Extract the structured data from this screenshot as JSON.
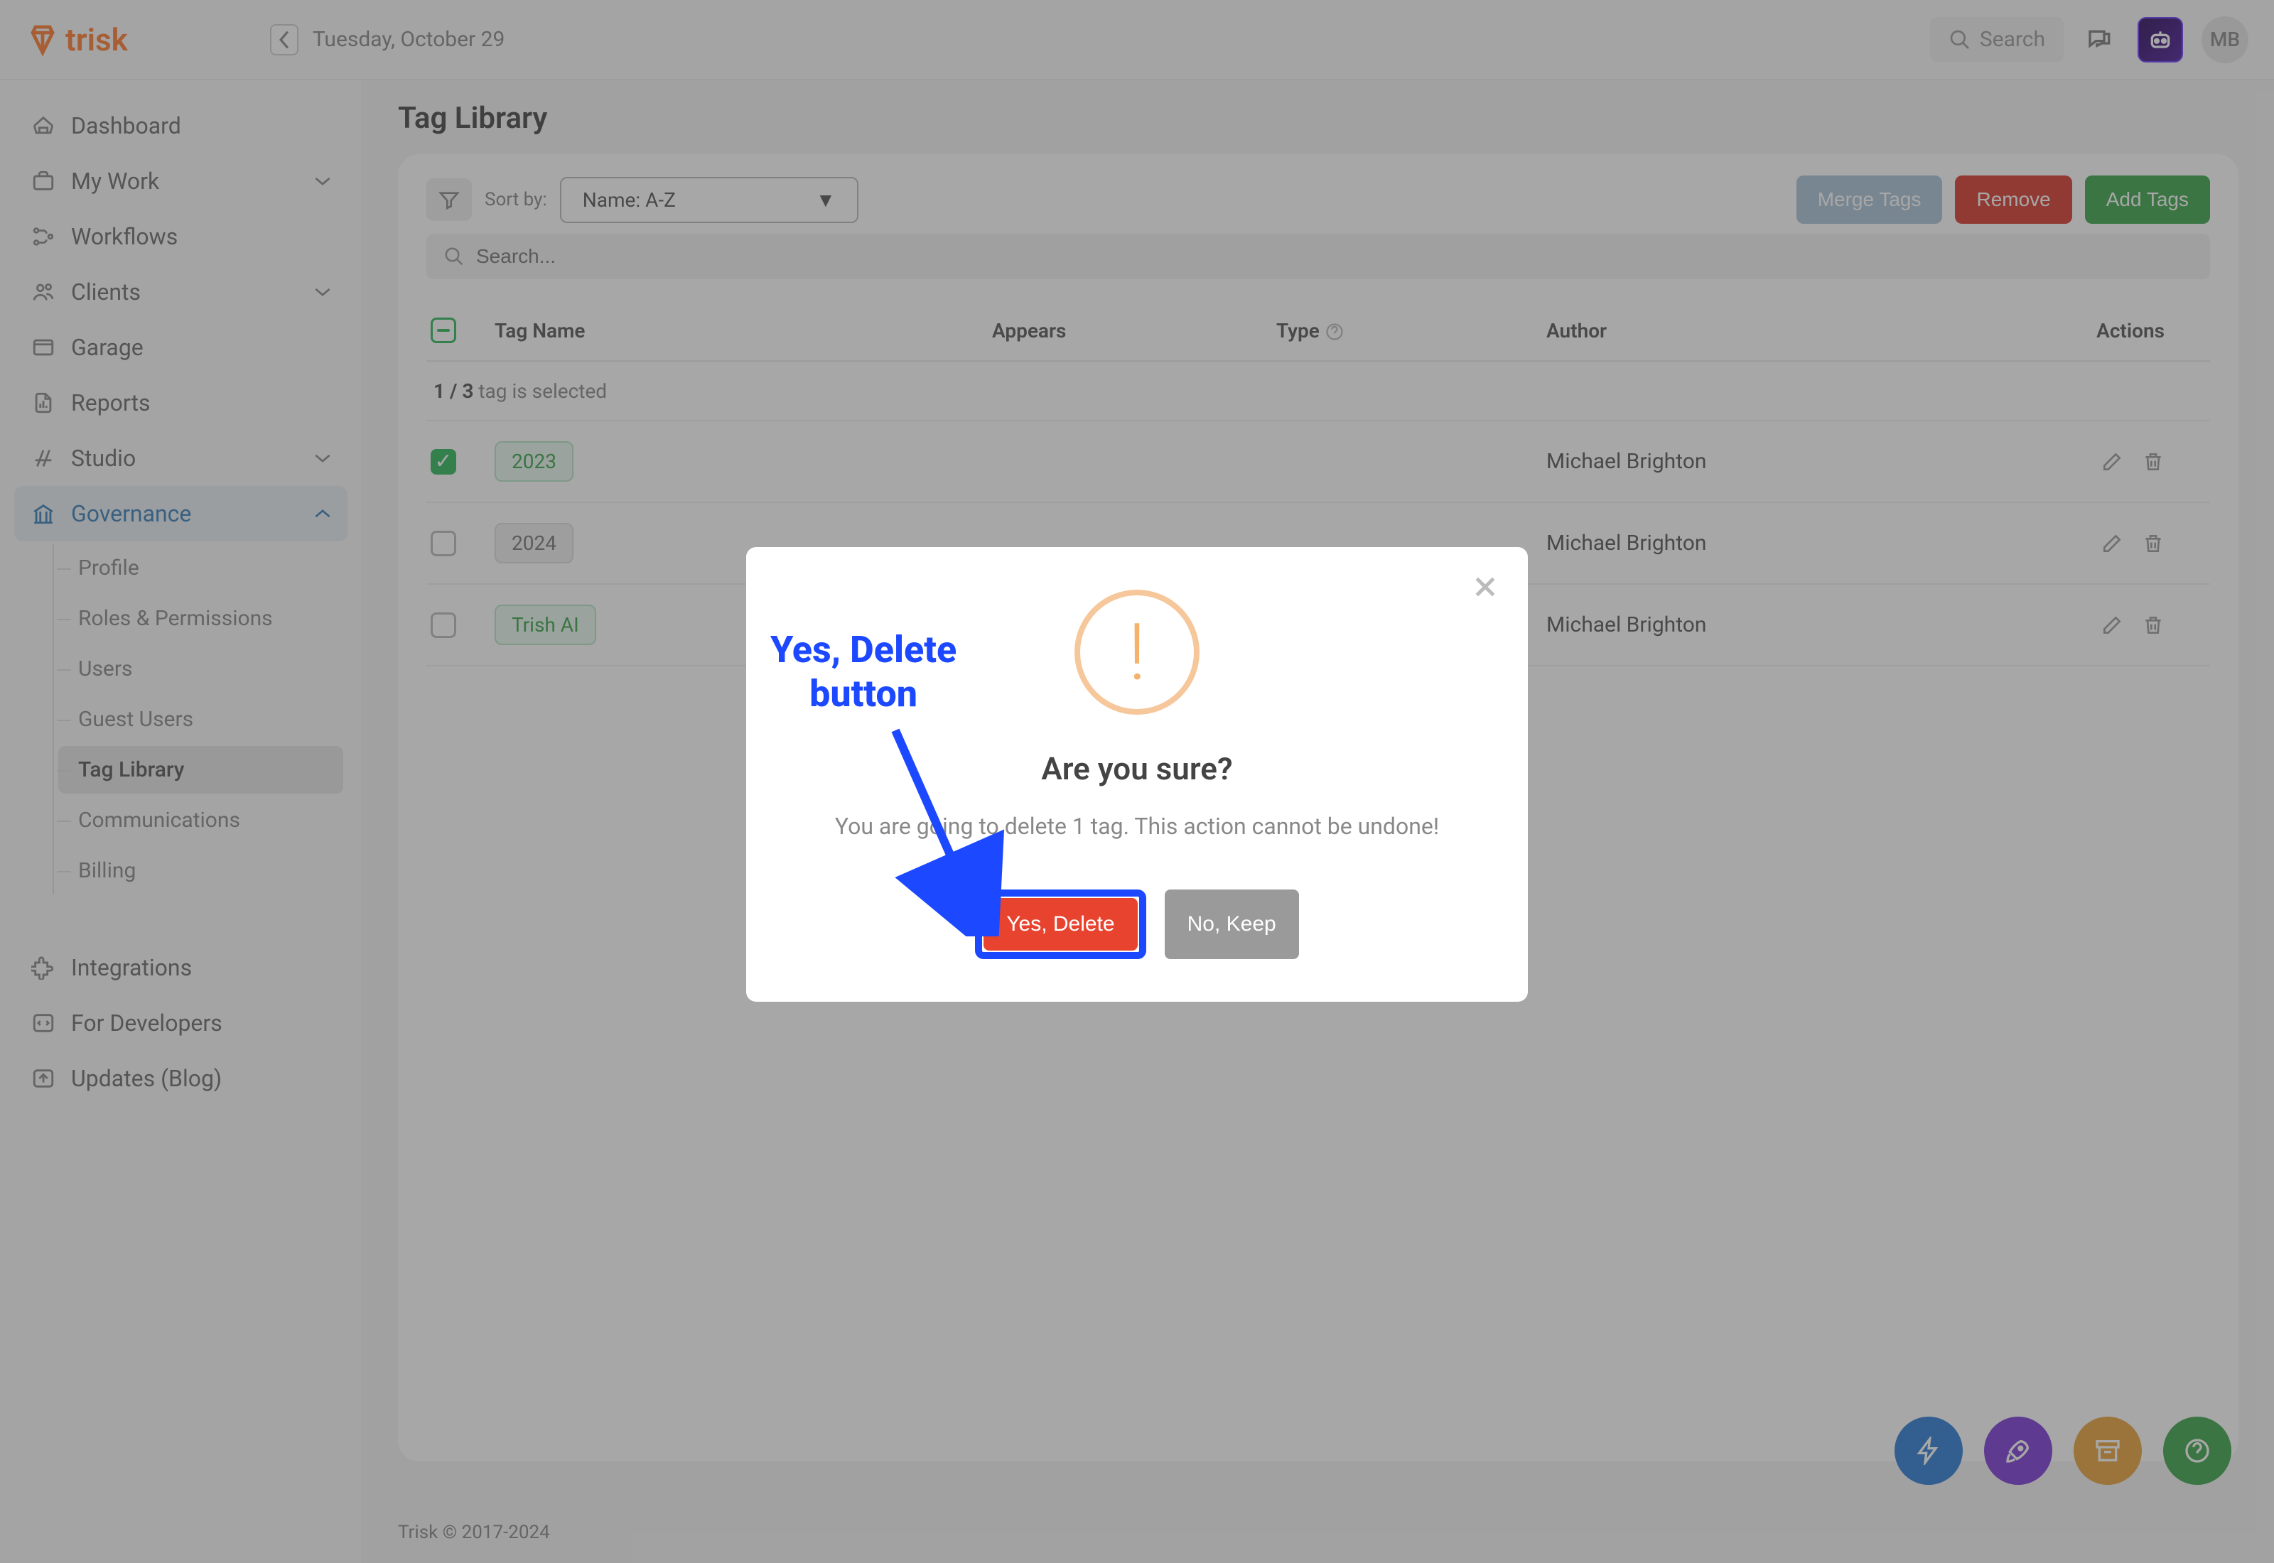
{
  "header": {
    "logo_text": "trisk",
    "date": "Tuesday, October 29",
    "search_placeholder": "Search",
    "avatar_initials": "MB"
  },
  "sidebar": {
    "items": [
      {
        "label": "Dashboard"
      },
      {
        "label": "My Work"
      },
      {
        "label": "Workflows"
      },
      {
        "label": "Clients"
      },
      {
        "label": "Garage"
      },
      {
        "label": "Reports"
      },
      {
        "label": "Studio"
      },
      {
        "label": "Governance"
      }
    ],
    "governance_children": [
      {
        "label": "Profile"
      },
      {
        "label": "Roles & Permissions"
      },
      {
        "label": "Users"
      },
      {
        "label": "Guest Users"
      },
      {
        "label": "Tag Library"
      },
      {
        "label": "Communications"
      },
      {
        "label": "Billing"
      }
    ],
    "bottom": [
      {
        "label": "Integrations"
      },
      {
        "label": "For Developers"
      },
      {
        "label": "Updates (Blog)"
      }
    ]
  },
  "page": {
    "title": "Tag Library",
    "sort_by_label": "Sort by:",
    "sort_value": "Name: A-Z",
    "merge_label": "Merge Tags",
    "remove_label": "Remove",
    "add_label": "Add Tags",
    "search_placeholder": "Search...",
    "columns": {
      "tag_name": "Tag Name",
      "appears": "Appears",
      "type": "Type",
      "author": "Author",
      "actions": "Actions"
    },
    "selection_text_pre": "1 / 3",
    "selection_text_post": " tag is selected",
    "rows": [
      {
        "checked": true,
        "tag": "2023",
        "pill": "green",
        "author": "Michael Brighton"
      },
      {
        "checked": false,
        "tag": "2024",
        "pill": "gray",
        "author": "Michael Brighton"
      },
      {
        "checked": false,
        "tag": "Trish AI",
        "pill": "green",
        "author": "Michael Brighton"
      }
    ],
    "footer": "Trisk © 2017-2024"
  },
  "modal": {
    "title": "Are you sure?",
    "message": "You are going to delete 1 tag. This action cannot be undone!",
    "yes_label": "Yes, Delete",
    "no_label": "No, Keep"
  },
  "annotation": {
    "line1": "Yes, Delete",
    "line2": "button"
  }
}
